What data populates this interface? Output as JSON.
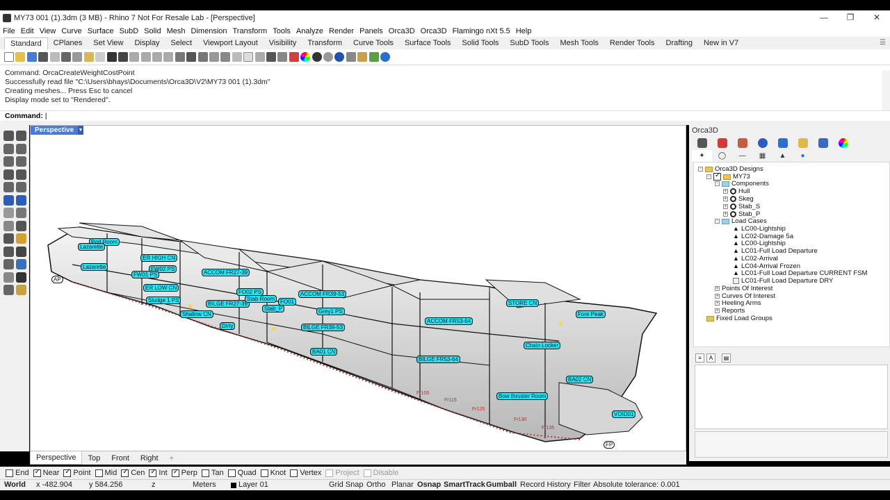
{
  "window": {
    "title": "MY73 001 (1).3dm (3 MB) - Rhino 7 Not For Resale Lab - [Perspective]",
    "minimize": "—",
    "maximize": "❐",
    "close": "✕"
  },
  "menu": [
    "File",
    "Edit",
    "View",
    "Curve",
    "Surface",
    "SubD",
    "Solid",
    "Mesh",
    "Dimension",
    "Transform",
    "Tools",
    "Analyze",
    "Render",
    "Panels",
    "Orca3D",
    "Orca3D",
    "Flamingo nXt 5.5",
    "Help"
  ],
  "tabs": [
    "Standard",
    "CPlanes",
    "Set View",
    "Display",
    "Select",
    "Viewport Layout",
    "Visibility",
    "Transform",
    "Curve Tools",
    "Surface Tools",
    "Solid Tools",
    "SubD Tools",
    "Mesh Tools",
    "Render Tools",
    "Drafting",
    "New in V7"
  ],
  "command": {
    "history": [
      "Command: OrcaCreateWeightCostPoint",
      "Successfully read file \"C:\\Users\\bhays\\Documents\\Orca3D\\V2\\MY73 001 (1).3dm\"",
      "Creating meshes... Press Esc to cancel",
      "Display mode set to \"Rendered\"."
    ],
    "prompt": "Command:"
  },
  "viewport": {
    "name": "Perspective",
    "labels": [
      "Pod Room",
      "Lazarette",
      "Lazarette",
      "ER HIGH CN",
      "FW02 PS",
      "FW01 PS",
      "ACCOM FR27-39",
      "ER LOW CN",
      "Sludge 1 PS",
      "BILGE FR27-39",
      "FO02 PS",
      "Stab Room",
      "FO01",
      "Stab_P",
      "ACCOM FR39-53",
      "Grey1 PS",
      "BILGE FR39-53",
      "Shallow CN",
      "Dirty",
      "BA01 CN",
      "ACCOM FR53-64",
      "BILGE FR53-64",
      "STORE CN",
      "Fore Peak",
      "Chain Locker",
      "Bow thruster Room",
      "BA02 CN",
      "VOID01",
      "AP",
      "FP",
      "Fr105",
      "Fr115",
      "Fr125",
      "Fr130",
      "Fr135"
    ]
  },
  "view_tabs": [
    "Perspective",
    "Top",
    "Front",
    "Right",
    "+"
  ],
  "osnaps": [
    {
      "label": "End",
      "checked": false
    },
    {
      "label": "Near",
      "checked": true
    },
    {
      "label": "Point",
      "checked": true
    },
    {
      "label": "Mid",
      "checked": false
    },
    {
      "label": "Cen",
      "checked": true
    },
    {
      "label": "Int",
      "checked": true
    },
    {
      "label": "Perp",
      "checked": true
    },
    {
      "label": "Tan",
      "checked": false
    },
    {
      "label": "Quad",
      "checked": false
    },
    {
      "label": "Knot",
      "checked": false
    },
    {
      "label": "Vertex",
      "checked": false
    },
    {
      "label": "Project",
      "checked": false,
      "disabled": true
    },
    {
      "label": "Disable",
      "checked": false,
      "disabled": true
    }
  ],
  "status": {
    "cplane": "World",
    "x": "x -482.904",
    "y": "y 584.256",
    "z": "z",
    "units": "Meters",
    "layer": "Layer 01",
    "grid_snap": "Grid Snap",
    "ortho": "Ortho",
    "planar": "Planar",
    "osnap": "Osnap",
    "smarttrack": "SmartTrack",
    "gumball": "Gumball",
    "record_history": "Record History",
    "filter": "Filter",
    "tolerance": "Absolute tolerance: 0.001"
  },
  "panel": {
    "title": "Orca3D",
    "tree": {
      "root": "Orca3D Designs",
      "design": "MY73",
      "components_label": "Components",
      "components": [
        "Hull",
        "Skeg",
        "Stab_S",
        "Stab_P"
      ],
      "load_cases_label": "Load Cases",
      "load_cases": [
        "LC00-Lightship",
        "LC02-Damage 5a",
        "LC00-Lightship",
        "LC01-Full Load Departure",
        "LC02-Arrival",
        "LC04-Arrival Frozen",
        "LC01-Full Load Departure CURRENT FSM",
        "LC01-Full Load Departure DRY"
      ],
      "others": [
        "Points Of Interest",
        "Curves Of Interest",
        "Heeling Arms",
        "Reports"
      ],
      "fixed": "Fixed Load Groups"
    }
  },
  "colors": {
    "label_fill": "#2de3f0",
    "viewport_tab": "#4a79d6"
  }
}
